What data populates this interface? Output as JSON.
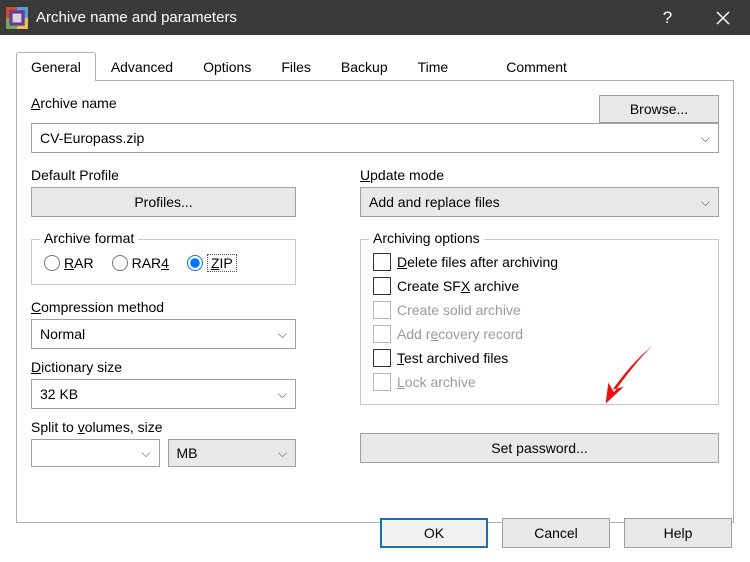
{
  "title": "Archive name and parameters",
  "tabs": [
    "General",
    "Advanced",
    "Options",
    "Files",
    "Backup",
    "Time",
    "Comment"
  ],
  "labels": {
    "archive_name": "Archive name",
    "browse": "Browse...",
    "default_profile": "Default Profile",
    "profiles": "Profiles...",
    "archive_format": "Archive format",
    "compression": "Compression method",
    "dictionary": "Dictionary size",
    "split": "Split to volumes, size",
    "update_mode": "Update mode",
    "arch_options": "Archiving options",
    "set_password": "Set password...",
    "ok": "OK",
    "cancel": "Cancel",
    "help": "Help"
  },
  "values": {
    "archive_name": "CV-Europass.zip",
    "compression": "Normal",
    "dictionary": "32 KB",
    "split_volume": "",
    "split_unit": "MB",
    "update_mode": "Add and replace files"
  },
  "formats": {
    "rar": "RAR",
    "rar4": "RAR4",
    "zip": "ZIP"
  },
  "options": {
    "delete": "Delete files after archiving",
    "sfx": "Create SFX archive",
    "solid": "Create solid archive",
    "recovery": "Add recovery record",
    "test": "Test archived files",
    "lock": "Lock archive"
  }
}
